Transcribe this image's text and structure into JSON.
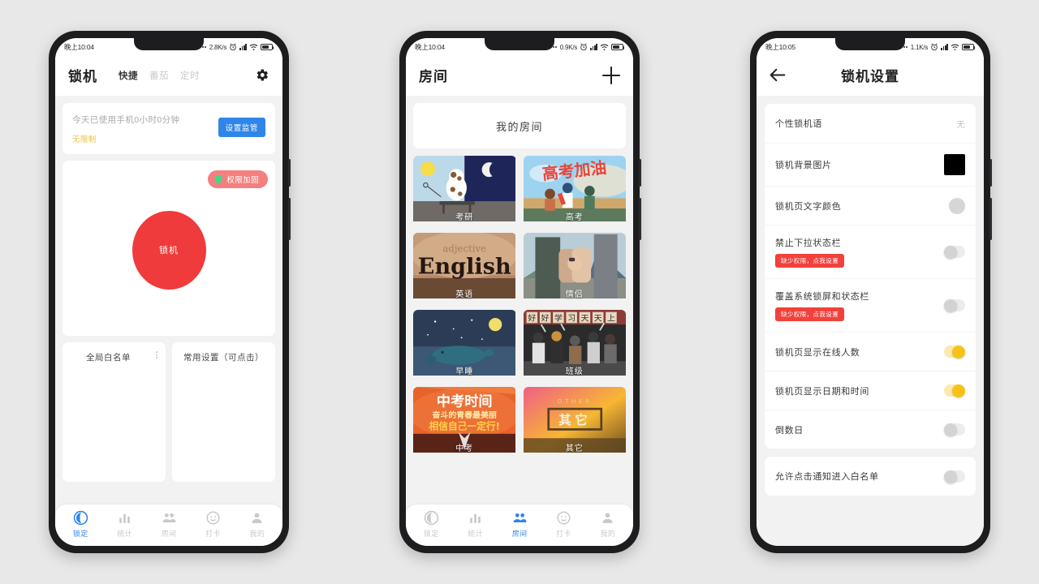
{
  "phones": {
    "lock": {
      "status": {
        "time": "晚上10:04",
        "net_speed": "2.8K/s",
        "alarm_icon": "alarm-icon",
        "signal_icon": "signal-icon",
        "wifi_icon": "wifi-icon",
        "battery_icon": "battery-icon"
      },
      "header": {
        "title": "锁机",
        "gear_icon": "gear-icon"
      },
      "tabs": [
        {
          "label": "快捷",
          "active": true
        },
        {
          "label": "番茄",
          "active": false
        },
        {
          "label": "定时",
          "active": false
        }
      ],
      "usage": {
        "text": "今天已使用手机0小时0分钟",
        "limit": "无限制",
        "button": "设置监管"
      },
      "lock_card": {
        "badge": "权限加固",
        "badge_icon": "shield-icon",
        "button": "锁机"
      },
      "bottom_cards": [
        {
          "title": "全局白名单",
          "menu_icon": "kebab-menu-icon"
        },
        {
          "title": "常用设置（可点击）"
        }
      ],
      "nav": [
        {
          "label": "锁定",
          "icon": "moon-icon",
          "active": true
        },
        {
          "label": "统计",
          "icon": "bar-chart-icon",
          "active": false
        },
        {
          "label": "房间",
          "icon": "people-icon",
          "active": false
        },
        {
          "label": "打卡",
          "icon": "smiley-icon",
          "active": false
        },
        {
          "label": "我的",
          "icon": "person-icon",
          "active": false
        }
      ]
    },
    "room": {
      "status": {
        "time": "晚上10:04",
        "net_speed": "0.9K/s",
        "alarm_icon": "alarm-icon",
        "signal_icon": "signal-icon",
        "wifi_icon": "wifi-icon",
        "battery_icon": "battery-icon"
      },
      "header": {
        "title": "房间",
        "add_icon": "plus-icon"
      },
      "my_room": "我的房间",
      "tiles": [
        {
          "label": "考研",
          "art": "night-study"
        },
        {
          "label": "高考",
          "art": "gaokao-cheer",
          "art_text": "高考加油"
        },
        {
          "label": "英语",
          "art": "english",
          "art_text": "English"
        },
        {
          "label": "情侣",
          "art": "couple"
        },
        {
          "label": "早睡",
          "art": "whale-night"
        },
        {
          "label": "班级",
          "art": "classroom",
          "art_text": "好好学习天天向上"
        },
        {
          "label": "中考",
          "art": "zhongkao",
          "art_text": "中考时间"
        },
        {
          "label": "其它",
          "art": "other",
          "art_text": "其 它"
        }
      ],
      "nav": [
        {
          "label": "锁定",
          "icon": "moon-icon",
          "active": false
        },
        {
          "label": "统计",
          "icon": "bar-chart-icon",
          "active": false
        },
        {
          "label": "房间",
          "icon": "people-icon",
          "active": true
        },
        {
          "label": "打卡",
          "icon": "smiley-icon",
          "active": false
        },
        {
          "label": "我的",
          "icon": "person-icon",
          "active": false
        }
      ]
    },
    "settings": {
      "status": {
        "time": "晚上10:05",
        "net_speed": "1.1K/s",
        "alarm_icon": "alarm-icon",
        "signal_icon": "signal-icon",
        "wifi_icon": "wifi-icon",
        "battery_icon": "battery-icon"
      },
      "header": {
        "title": "锁机设置",
        "back_icon": "back-arrow-icon"
      },
      "groups": [
        {
          "rows": [
            {
              "label": "个性锁机语",
              "control": "value",
              "value": "无"
            },
            {
              "label": "锁机背景图片",
              "control": "swatch",
              "color": "#000000"
            },
            {
              "label": "锁机页文字颜色",
              "control": "circle",
              "color": "#d6d6d6"
            },
            {
              "label": "禁止下拉状态栏",
              "control": "toggle",
              "on": false,
              "badge": "缺少权限，点我设置"
            },
            {
              "label": "覆盖系统锁屏和状态栏",
              "control": "toggle",
              "on": false,
              "badge": "缺少权限，点我设置"
            },
            {
              "label": "锁机页显示在线人数",
              "control": "toggle",
              "on": true
            },
            {
              "label": "锁机页显示日期和时间",
              "control": "toggle",
              "on": true
            },
            {
              "label": "倒数日",
              "control": "toggle",
              "on": false
            }
          ]
        },
        {
          "rows": [
            {
              "label": "允许点击通知进入白名单",
              "control": "toggle",
              "on": false
            }
          ]
        }
      ]
    }
  }
}
